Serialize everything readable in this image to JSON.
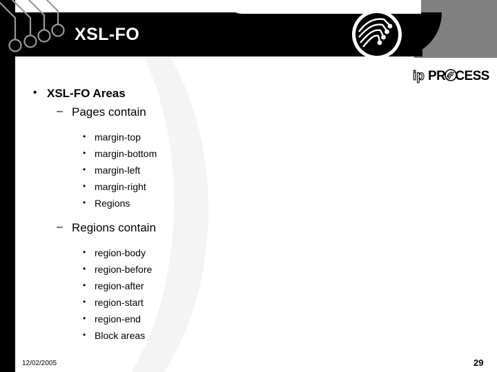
{
  "slide": {
    "title": "XSL-FO",
    "theme": {
      "band_color": "#000000",
      "gray_block_color": "#808080",
      "panel_color": "#ffffff",
      "title_color": "#ffffff",
      "text_color": "#000000",
      "circuit_trace_color": "#9a9a9a"
    }
  },
  "logo": {
    "badge_icon": "circuit-badge-icon",
    "wordmark_prefix": "ip",
    "wordmark_main": "PROCESS",
    "wordmark_full": "ipPROCESS"
  },
  "decoration": {
    "corner_icon": "circuit-traces-icon"
  },
  "bullets": [
    {
      "level": 1,
      "marker": "•",
      "text": "XSL-FO Areas"
    },
    {
      "level": 2,
      "marker": "–",
      "text": "Pages contain"
    },
    {
      "level": 3,
      "marker": "•",
      "text": "margin-top"
    },
    {
      "level": 3,
      "marker": "•",
      "text": "margin-bottom"
    },
    {
      "level": 3,
      "marker": "•",
      "text": "margin-left"
    },
    {
      "level": 3,
      "marker": "•",
      "text": "margin-right"
    },
    {
      "level": 3,
      "marker": "•",
      "text": "Regions"
    },
    {
      "level": 2,
      "marker": "–",
      "text": "Regions contain"
    },
    {
      "level": 3,
      "marker": "•",
      "text": "region-body"
    },
    {
      "level": 3,
      "marker": "•",
      "text": "region-before"
    },
    {
      "level": 3,
      "marker": "•",
      "text": "region-after"
    },
    {
      "level": 3,
      "marker": "•",
      "text": "region-start"
    },
    {
      "level": 3,
      "marker": "•",
      "text": "region-end"
    },
    {
      "level": 3,
      "marker": "•",
      "text": "Block areas"
    }
  ],
  "footer": {
    "date": "12/02/2005",
    "page_number": "29"
  }
}
